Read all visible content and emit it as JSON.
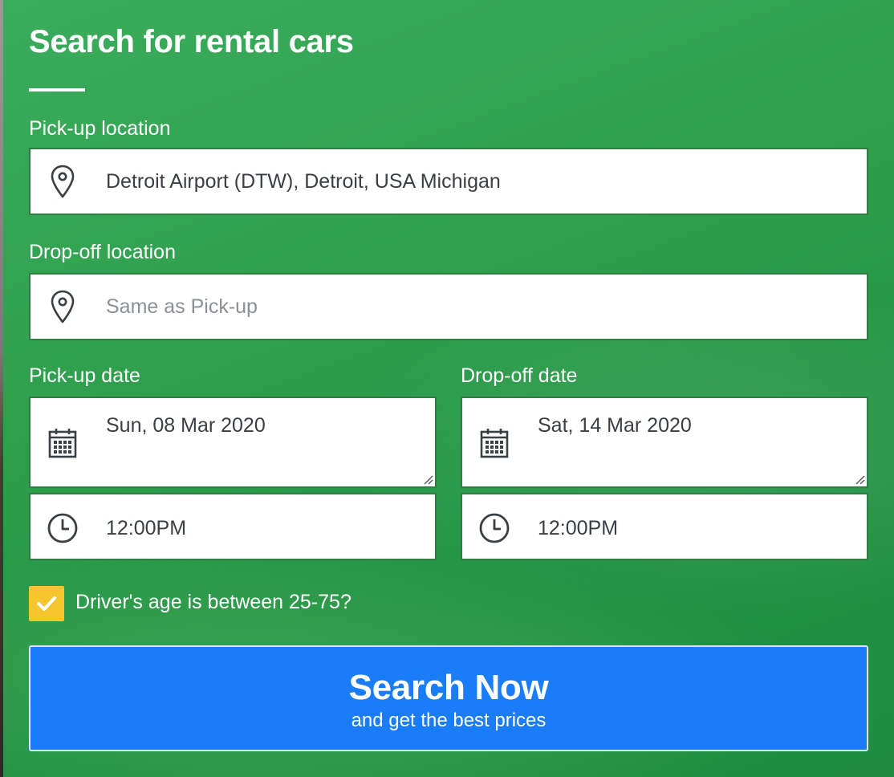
{
  "title": "Search for rental cars",
  "pickup_location": {
    "label": "Pick-up location",
    "value": "Detroit Airport (DTW), Detroit, USA Michigan",
    "icon": "map-pin-icon"
  },
  "dropoff_location": {
    "label": "Drop-off location",
    "placeholder": "Same as Pick-up",
    "icon": "map-pin-icon"
  },
  "pickup_date": {
    "label": "Pick-up date",
    "date": "Sun, 08 Mar 2020",
    "time": "12:00PM"
  },
  "dropoff_date": {
    "label": "Drop-off date",
    "date": "Sat, 14 Mar 2020",
    "time": "12:00PM"
  },
  "driver_age": {
    "label": "Driver's age is between 25-75?",
    "checked": true
  },
  "search_button": {
    "label": "Search Now",
    "sublabel": "and get the best prices"
  },
  "colors": {
    "background": "#2f9f4d",
    "button": "#1a7cf6",
    "checkbox": "#f4c52c"
  }
}
